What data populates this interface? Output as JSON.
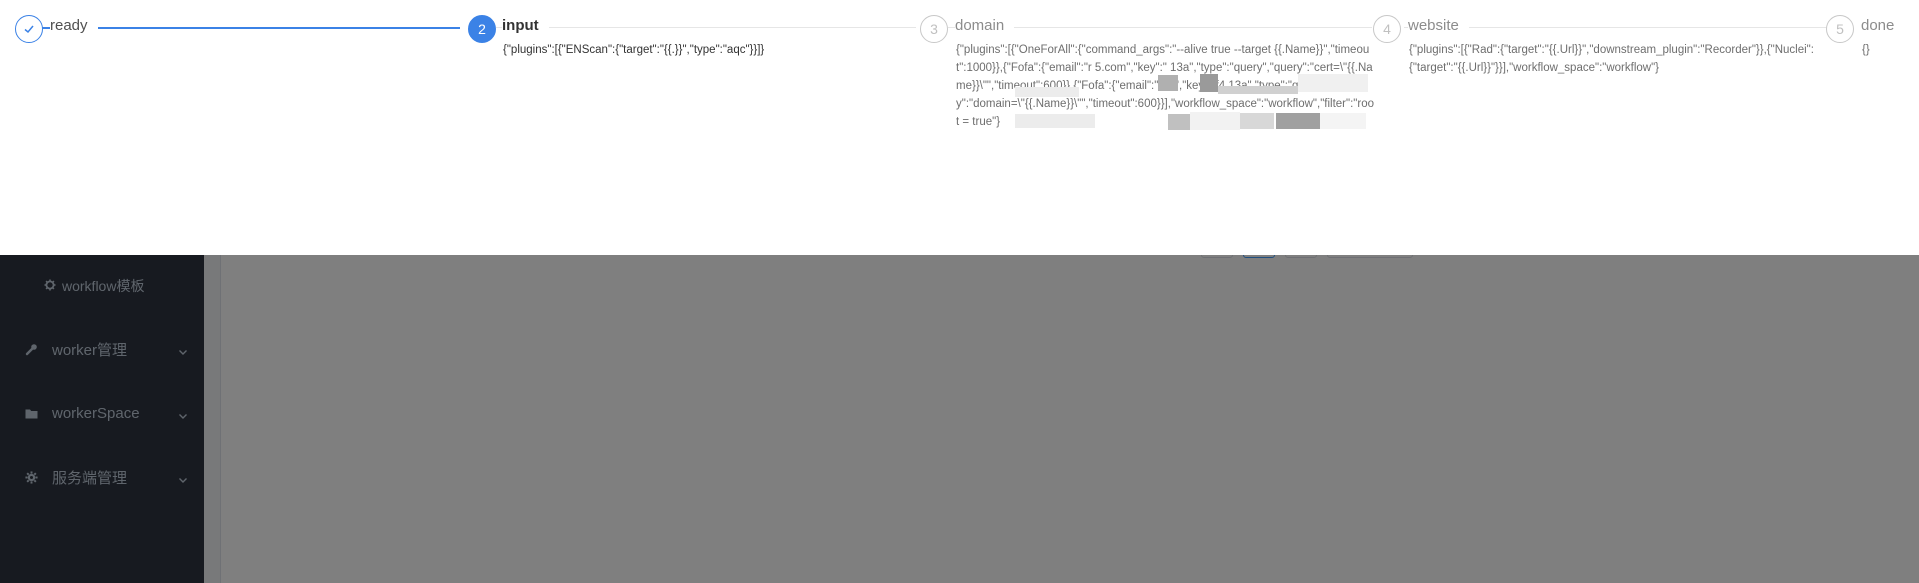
{
  "steps": [
    {
      "index": "1",
      "title": "ready",
      "description": "",
      "status": "finished"
    },
    {
      "index": "2",
      "title": "input",
      "description": "{\"plugins\":[{\"ENScan\":{\"target\":\"{{.}}\",\"type\":\"aqc\"}}]}",
      "status": "process"
    },
    {
      "index": "3",
      "title": "domain",
      "description": "{\"plugins\":[{\"OneForAll\":{\"command_args\":\"--alive true --target {{.Name}}\",\"timeout\":1000}},{\"Fofa\":{\"email\":\"r                    5.com\",\"key\":\"                                        13a\",\"type\":\"query\",\"query\":\"cert=\\\"{{.Name}}\\\"\",\"timeout\":600}},{\"Fofa\":{\"email\":\"r                    m\",\"key\":\"f4                                      13a\",\"type\":\"query\",\"query\":\"domain=\\\"{{.Name}}\\\"\",\"timeout\":600}}],\"workflow_space\":\"workflow\",\"filter\":\"root = true\"}",
      "status": "wait"
    },
    {
      "index": "4",
      "title": "website",
      "description": "{\"plugins\":[{\"Rad\":{\"target\":\"{{.Url}}\",\"downstream_plugin\":\"Recorder\"}},{\"Nuclei\":{\"target\":\"{{.Url}}\"}}],\"workflow_space\":\"workflow\"}",
      "status": "wait"
    },
    {
      "index": "5",
      "title": "done",
      "description": "{}",
      "status": "wait"
    }
  ],
  "sidebar": {
    "sub_item": {
      "label": "workflow模板",
      "icon": "gear-icon"
    },
    "items": [
      {
        "label": "worker管理",
        "icon": "wrench-icon"
      },
      {
        "label": "workerSpace",
        "icon": "folder-icon"
      },
      {
        "label": "服务端管理",
        "icon": "gear-icon"
      }
    ]
  },
  "colors": {
    "accent": "#3b82e6",
    "sidebar_bg": "#2f3540",
    "sidebar_text": "#bfcbd9"
  }
}
